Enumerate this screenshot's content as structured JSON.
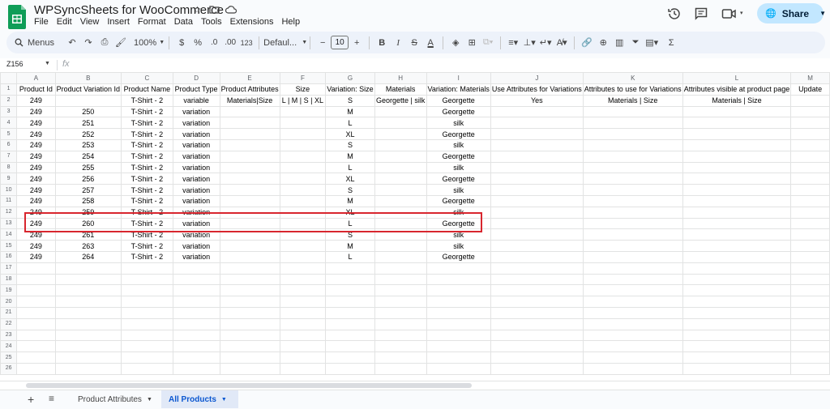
{
  "app": {
    "title": "WPSyncSheets for WooCommerce",
    "menu": [
      "File",
      "Edit",
      "View",
      "Insert",
      "Format",
      "Data",
      "Tools",
      "Extensions",
      "Help"
    ],
    "share_label": "Share"
  },
  "toolbar": {
    "menus_label": "Menus",
    "zoom": "100%",
    "currency": "$",
    "percent": "%",
    "dec_decrease": ".0",
    "dec_increase": ".00",
    "number_format": "123",
    "font": "Defaul...",
    "font_size": "10",
    "bold": "B",
    "italic": "I",
    "sigma": "Σ"
  },
  "formula_bar": {
    "cell_ref": "Z156",
    "fx": "fx"
  },
  "columns": [
    "A",
    "B",
    "C",
    "D",
    "E",
    "F",
    "G",
    "H",
    "I",
    "J",
    "K",
    "L",
    "M"
  ],
  "headers": [
    "Product Id",
    "Product Variation Id",
    "Product Name",
    "Product Type",
    "Product Attributes",
    "Size",
    "Variation: Size",
    "Materials",
    "Variation: Materials",
    "Use Attributes for Variations",
    "Attributes to use for Variations",
    "Attributes visible at product page",
    "Update"
  ],
  "rows": [
    [
      "249",
      "",
      "T-Shirt - 2",
      "variable",
      "Materials|Size",
      "L | M | S | XL",
      "S",
      "Georgette | silk",
      "Georgette",
      "Yes",
      "Materials | Size",
      "Materials | Size",
      ""
    ],
    [
      "249",
      "250",
      "T-Shirt - 2",
      "variation",
      "",
      "",
      "M",
      "",
      "Georgette",
      "",
      "",
      "",
      ""
    ],
    [
      "249",
      "251",
      "T-Shirt - 2",
      "variation",
      "",
      "",
      "L",
      "",
      "silk",
      "",
      "",
      "",
      ""
    ],
    [
      "249",
      "252",
      "T-Shirt - 2",
      "variation",
      "",
      "",
      "XL",
      "",
      "Georgette",
      "",
      "",
      "",
      ""
    ],
    [
      "249",
      "253",
      "T-Shirt - 2",
      "variation",
      "",
      "",
      "S",
      "",
      "silk",
      "",
      "",
      "",
      ""
    ],
    [
      "249",
      "254",
      "T-Shirt - 2",
      "variation",
      "",
      "",
      "M",
      "",
      "Georgette",
      "",
      "",
      "",
      ""
    ],
    [
      "249",
      "255",
      "T-Shirt - 2",
      "variation",
      "",
      "",
      "L",
      "",
      "silk",
      "",
      "",
      "",
      ""
    ],
    [
      "249",
      "256",
      "T-Shirt - 2",
      "variation",
      "",
      "",
      "XL",
      "",
      "Georgette",
      "",
      "",
      "",
      ""
    ],
    [
      "249",
      "257",
      "T-Shirt - 2",
      "variation",
      "",
      "",
      "S",
      "",
      "silk",
      "",
      "",
      "",
      ""
    ],
    [
      "249",
      "258",
      "T-Shirt - 2",
      "variation",
      "",
      "",
      "M",
      "",
      "Georgette",
      "",
      "",
      "",
      ""
    ],
    [
      "249",
      "259",
      "T-Shirt - 2",
      "variation",
      "",
      "",
      "XL",
      "",
      "silk",
      "",
      "",
      "",
      ""
    ],
    [
      "249",
      "260",
      "T-Shirt - 2",
      "variation",
      "",
      "",
      "L",
      "",
      "Georgette",
      "",
      "",
      "",
      ""
    ],
    [
      "249",
      "261",
      "T-Shirt - 2",
      "variation",
      "",
      "",
      "S",
      "",
      "silk",
      "",
      "",
      "",
      ""
    ],
    [
      "249",
      "263",
      "T-Shirt - 2",
      "variation",
      "",
      "",
      "M",
      "",
      "silk",
      "",
      "",
      "",
      ""
    ],
    [
      "249",
      "264",
      "T-Shirt - 2",
      "variation",
      "",
      "",
      "L",
      "",
      "Georgette",
      "",
      "",
      "",
      ""
    ]
  ],
  "total_rows": 26,
  "sheets": [
    {
      "label": "Product Attributes",
      "active": false
    },
    {
      "label": "All Products",
      "active": true
    }
  ],
  "colors": {
    "accent": "#0b57d0",
    "share_bg": "#c2e7ff",
    "highlight_border": "#d8262e",
    "sheets_green": "#0f9d58"
  }
}
